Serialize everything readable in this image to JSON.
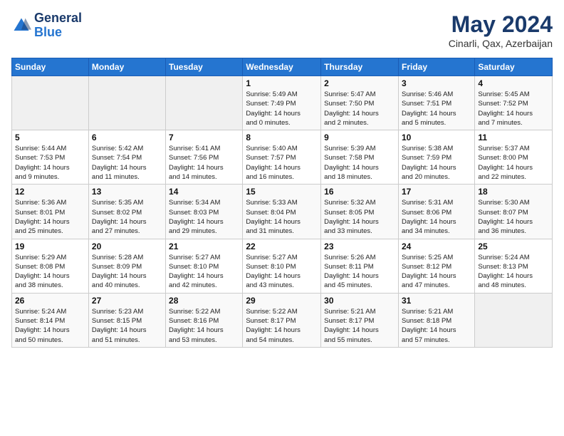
{
  "header": {
    "logo": {
      "general": "General",
      "blue": "Blue"
    },
    "title": "May 2024",
    "location": "Cinarli, Qax, Azerbaijan"
  },
  "weekdays": [
    "Sunday",
    "Monday",
    "Tuesday",
    "Wednesday",
    "Thursday",
    "Friday",
    "Saturday"
  ],
  "weeks": [
    [
      {
        "day": "",
        "info": ""
      },
      {
        "day": "",
        "info": ""
      },
      {
        "day": "",
        "info": ""
      },
      {
        "day": "1",
        "info": "Sunrise: 5:49 AM\nSunset: 7:49 PM\nDaylight: 14 hours\nand 0 minutes."
      },
      {
        "day": "2",
        "info": "Sunrise: 5:47 AM\nSunset: 7:50 PM\nDaylight: 14 hours\nand 2 minutes."
      },
      {
        "day": "3",
        "info": "Sunrise: 5:46 AM\nSunset: 7:51 PM\nDaylight: 14 hours\nand 5 minutes."
      },
      {
        "day": "4",
        "info": "Sunrise: 5:45 AM\nSunset: 7:52 PM\nDaylight: 14 hours\nand 7 minutes."
      }
    ],
    [
      {
        "day": "5",
        "info": "Sunrise: 5:44 AM\nSunset: 7:53 PM\nDaylight: 14 hours\nand 9 minutes."
      },
      {
        "day": "6",
        "info": "Sunrise: 5:42 AM\nSunset: 7:54 PM\nDaylight: 14 hours\nand 11 minutes."
      },
      {
        "day": "7",
        "info": "Sunrise: 5:41 AM\nSunset: 7:56 PM\nDaylight: 14 hours\nand 14 minutes."
      },
      {
        "day": "8",
        "info": "Sunrise: 5:40 AM\nSunset: 7:57 PM\nDaylight: 14 hours\nand 16 minutes."
      },
      {
        "day": "9",
        "info": "Sunrise: 5:39 AM\nSunset: 7:58 PM\nDaylight: 14 hours\nand 18 minutes."
      },
      {
        "day": "10",
        "info": "Sunrise: 5:38 AM\nSunset: 7:59 PM\nDaylight: 14 hours\nand 20 minutes."
      },
      {
        "day": "11",
        "info": "Sunrise: 5:37 AM\nSunset: 8:00 PM\nDaylight: 14 hours\nand 22 minutes."
      }
    ],
    [
      {
        "day": "12",
        "info": "Sunrise: 5:36 AM\nSunset: 8:01 PM\nDaylight: 14 hours\nand 25 minutes."
      },
      {
        "day": "13",
        "info": "Sunrise: 5:35 AM\nSunset: 8:02 PM\nDaylight: 14 hours\nand 27 minutes."
      },
      {
        "day": "14",
        "info": "Sunrise: 5:34 AM\nSunset: 8:03 PM\nDaylight: 14 hours\nand 29 minutes."
      },
      {
        "day": "15",
        "info": "Sunrise: 5:33 AM\nSunset: 8:04 PM\nDaylight: 14 hours\nand 31 minutes."
      },
      {
        "day": "16",
        "info": "Sunrise: 5:32 AM\nSunset: 8:05 PM\nDaylight: 14 hours\nand 33 minutes."
      },
      {
        "day": "17",
        "info": "Sunrise: 5:31 AM\nSunset: 8:06 PM\nDaylight: 14 hours\nand 34 minutes."
      },
      {
        "day": "18",
        "info": "Sunrise: 5:30 AM\nSunset: 8:07 PM\nDaylight: 14 hours\nand 36 minutes."
      }
    ],
    [
      {
        "day": "19",
        "info": "Sunrise: 5:29 AM\nSunset: 8:08 PM\nDaylight: 14 hours\nand 38 minutes."
      },
      {
        "day": "20",
        "info": "Sunrise: 5:28 AM\nSunset: 8:09 PM\nDaylight: 14 hours\nand 40 minutes."
      },
      {
        "day": "21",
        "info": "Sunrise: 5:27 AM\nSunset: 8:10 PM\nDaylight: 14 hours\nand 42 minutes."
      },
      {
        "day": "22",
        "info": "Sunrise: 5:27 AM\nSunset: 8:10 PM\nDaylight: 14 hours\nand 43 minutes."
      },
      {
        "day": "23",
        "info": "Sunrise: 5:26 AM\nSunset: 8:11 PM\nDaylight: 14 hours\nand 45 minutes."
      },
      {
        "day": "24",
        "info": "Sunrise: 5:25 AM\nSunset: 8:12 PM\nDaylight: 14 hours\nand 47 minutes."
      },
      {
        "day": "25",
        "info": "Sunrise: 5:24 AM\nSunset: 8:13 PM\nDaylight: 14 hours\nand 48 minutes."
      }
    ],
    [
      {
        "day": "26",
        "info": "Sunrise: 5:24 AM\nSunset: 8:14 PM\nDaylight: 14 hours\nand 50 minutes."
      },
      {
        "day": "27",
        "info": "Sunrise: 5:23 AM\nSunset: 8:15 PM\nDaylight: 14 hours\nand 51 minutes."
      },
      {
        "day": "28",
        "info": "Sunrise: 5:22 AM\nSunset: 8:16 PM\nDaylight: 14 hours\nand 53 minutes."
      },
      {
        "day": "29",
        "info": "Sunrise: 5:22 AM\nSunset: 8:17 PM\nDaylight: 14 hours\nand 54 minutes."
      },
      {
        "day": "30",
        "info": "Sunrise: 5:21 AM\nSunset: 8:17 PM\nDaylight: 14 hours\nand 55 minutes."
      },
      {
        "day": "31",
        "info": "Sunrise: 5:21 AM\nSunset: 8:18 PM\nDaylight: 14 hours\nand 57 minutes."
      },
      {
        "day": "",
        "info": ""
      }
    ]
  ]
}
